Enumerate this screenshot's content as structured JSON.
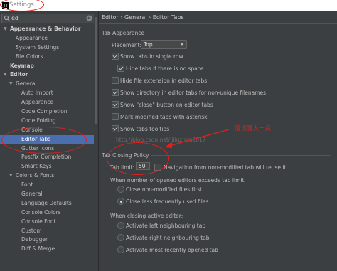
{
  "window": {
    "title": "Settings"
  },
  "search": {
    "value": "ed"
  },
  "tree": [
    {
      "label": "Appearance & Behavior",
      "level": 0,
      "arrow": "down",
      "bold": true
    },
    {
      "label": "Appearance",
      "level": 1
    },
    {
      "label": "System Settings",
      "level": 1
    },
    {
      "label": "File Colors",
      "level": 1
    },
    {
      "label": "Keymap",
      "level": 0,
      "bold": true
    },
    {
      "label": "Editor",
      "level": 0,
      "arrow": "down",
      "bold": true
    },
    {
      "label": "General",
      "level": 1,
      "arrow": "down"
    },
    {
      "label": "Auto Import",
      "level": 2
    },
    {
      "label": "Appearance",
      "level": 2
    },
    {
      "label": "Code Completion",
      "level": 2
    },
    {
      "label": "Code Folding",
      "level": 2
    },
    {
      "label": "Console",
      "level": 2
    },
    {
      "label": "Editor Tabs",
      "level": 2,
      "selected": true
    },
    {
      "label": "Gutter Icons",
      "level": 2
    },
    {
      "label": "Postfix Completion",
      "level": 2
    },
    {
      "label": "Smart Keys",
      "level": 2
    },
    {
      "label": "Colors & Fonts",
      "level": 1,
      "arrow": "down"
    },
    {
      "label": "Font",
      "level": 2
    },
    {
      "label": "General",
      "level": 2
    },
    {
      "label": "Language Defaults",
      "level": 2
    },
    {
      "label": "Console Colors",
      "level": 2
    },
    {
      "label": "Console Font",
      "level": 2
    },
    {
      "label": "Custom",
      "level": 2
    },
    {
      "label": "Debugger",
      "level": 2
    },
    {
      "label": "Diff & Merge",
      "level": 2
    }
  ],
  "breadcrumb": "Editor › General › Editor Tabs",
  "tab_appearance": {
    "header": "Tab Appearance",
    "placement_label": "Placement:",
    "placement_value": "Top",
    "options": [
      {
        "label": "Show tabs in single row",
        "checked": true
      },
      {
        "label": "Hide tabs if there is no space",
        "checked": true
      },
      {
        "label": "Hide file extension in editor tabs",
        "checked": false
      },
      {
        "label": "Show directory in editor tabs for non-unique filenames",
        "checked": true
      },
      {
        "label": "Show \"close\" button on editor tabs",
        "checked": true
      },
      {
        "label": "Mark modified tabs with asterisk",
        "checked": false
      },
      {
        "label": "Show tabs tooltips",
        "checked": true
      }
    ]
  },
  "tab_closing": {
    "header": "Tab Closing Policy",
    "tab_limit_label": "Tab limit:",
    "tab_limit_value": "50",
    "navigation_label": "Navigation from non-modified tab will reuse it",
    "navigation_checked": false,
    "exceeds_label": "When number of opened editors exceeds tab limit:",
    "exceeds_options": [
      {
        "label": "Close non-modified files first",
        "checked": false
      },
      {
        "label": "Close less frequently used files",
        "checked": true
      }
    ],
    "closing_label": "When closing active editor:",
    "closing_options": [
      {
        "label": "Activate left neighbouring tab",
        "checked": false
      },
      {
        "label": "Activate right neighbouring tab",
        "checked": false
      },
      {
        "label": "Activate most recently opened tab",
        "checked": false
      }
    ]
  },
  "watermark": "http://blog.csdn.net/lijiuzhou2017",
  "annotation": "值设置大一点",
  "colors": {
    "selection": "#4b6eaf",
    "annotation": "#e0201c",
    "background": "#3c3f41"
  }
}
